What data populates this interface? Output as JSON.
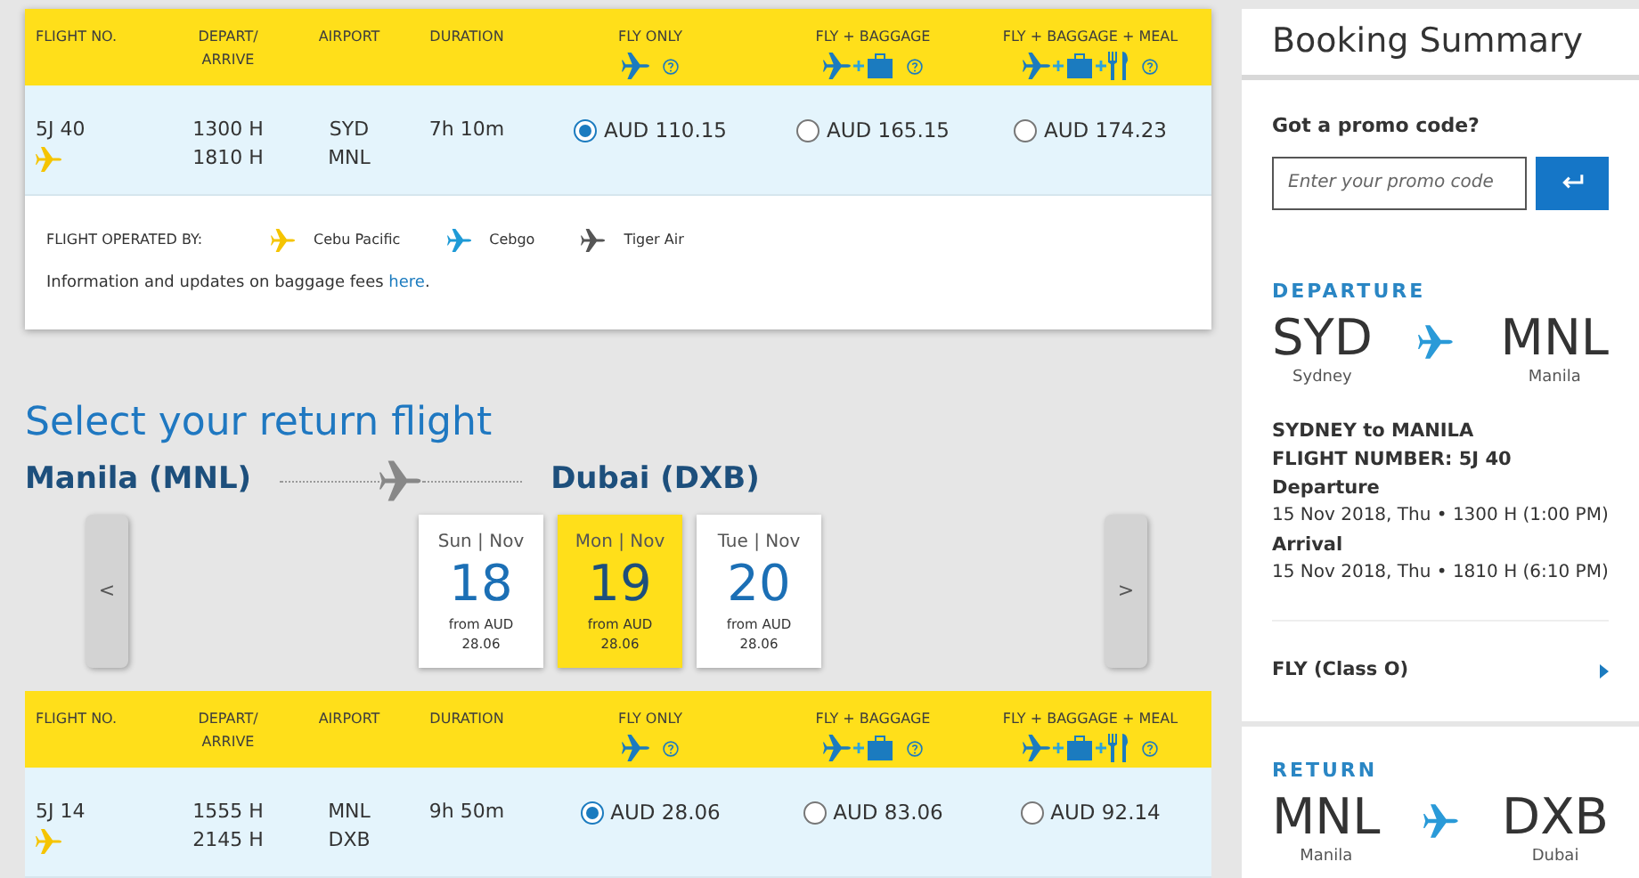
{
  "outbound": {
    "columns": [
      {
        "label": "FLIGHT NO.",
        "kind": "text"
      },
      {
        "label": "DEPART/ ARRIVE",
        "kind": "text"
      },
      {
        "label": "AIRPORT",
        "kind": "text"
      },
      {
        "label": "DURATION",
        "kind": "text"
      },
      {
        "label": "FLY ONLY",
        "kind": "fly"
      },
      {
        "label": "FLY + BAGGAGE",
        "kind": "baggage"
      },
      {
        "label": "FLY + BAGGAGE + MEAL",
        "kind": "meal"
      }
    ],
    "flights": [
      {
        "flight_no": "5J 40",
        "color": "#f5c400",
        "depart": "1300 H",
        "arrive": "1810 H",
        "from": "SYD",
        "to": "MNL",
        "duration": "7h 10m",
        "fares": [
          {
            "price": "AUD 110.15",
            "selected": true
          },
          {
            "price": "AUD 165.15",
            "selected": false
          },
          {
            "price": "AUD 174.23",
            "selected": false
          }
        ]
      }
    ],
    "operated_by": {
      "label": "FLIGHT OPERATED BY:",
      "airlines": [
        {
          "name": "Cebu Pacific",
          "color": "#f5c400"
        },
        {
          "name": "Cebgo",
          "color": "#1e9ad6"
        },
        {
          "name": "Tiger Air",
          "color": "#555555"
        }
      ]
    },
    "note": {
      "text": "Information and updates on baggage fees",
      "link": "here",
      "end": "."
    }
  },
  "return_section": {
    "title": "Select your return flight",
    "origin": "Manila (MNL)",
    "destination": "Dubai (DXB)",
    "prev": "<",
    "next": ">",
    "dates": [
      {
        "day": "Sun | Nov",
        "date": "18",
        "from": "from AUD",
        "price": "28.06",
        "selected": false
      },
      {
        "day": "Mon | Nov",
        "date": "19",
        "from": "from AUD",
        "price": "28.06",
        "selected": true
      },
      {
        "day": "Tue | Nov",
        "date": "20",
        "from": "from AUD",
        "price": "28.06",
        "selected": false
      }
    ]
  },
  "return_table": {
    "columns": [
      {
        "label": "FLIGHT NO.",
        "kind": "text"
      },
      {
        "label": "DEPART/ ARRIVE",
        "kind": "text"
      },
      {
        "label": "AIRPORT",
        "kind": "text"
      },
      {
        "label": "DURATION",
        "kind": "text"
      },
      {
        "label": "FLY ONLY",
        "kind": "fly"
      },
      {
        "label": "FLY + BAGGAGE",
        "kind": "baggage"
      },
      {
        "label": "FLY + BAGGAGE + MEAL",
        "kind": "meal"
      }
    ],
    "flights": [
      {
        "flight_no": "5J 14",
        "color": "#f5c400",
        "depart": "1555 H",
        "arrive": "2145 H",
        "from": "MNL",
        "to": "DXB",
        "duration": "9h 50m",
        "fares": [
          {
            "price": "AUD 28.06",
            "selected": true
          },
          {
            "price": "AUD 83.06",
            "selected": false
          },
          {
            "price": "AUD 92.14",
            "selected": false
          }
        ]
      }
    ]
  },
  "summary": {
    "title": "Booking Summary",
    "promo_label": "Got a promo code?",
    "promo_placeholder": "Enter your promo code",
    "departure": {
      "label": "DEPARTURE",
      "from_code": "SYD",
      "from_city": "Sydney",
      "to_code": "MNL",
      "to_city": "Manila",
      "route": "SYDNEY to MANILA",
      "flight_number": "FLIGHT NUMBER: 5J 40",
      "departure_label": "Departure",
      "departure_time": "15 Nov 2018, Thu • 1300 H (1:00 PM)",
      "arrival_label": "Arrival",
      "arrival_time": "15 Nov 2018, Thu • 1810 H (6:10 PM)",
      "fare": "FLY (Class O)"
    },
    "return": {
      "label": "RETURN",
      "from_code": "MNL",
      "from_city": "Manila",
      "to_code": "DXB",
      "to_city": "Dubai"
    }
  }
}
